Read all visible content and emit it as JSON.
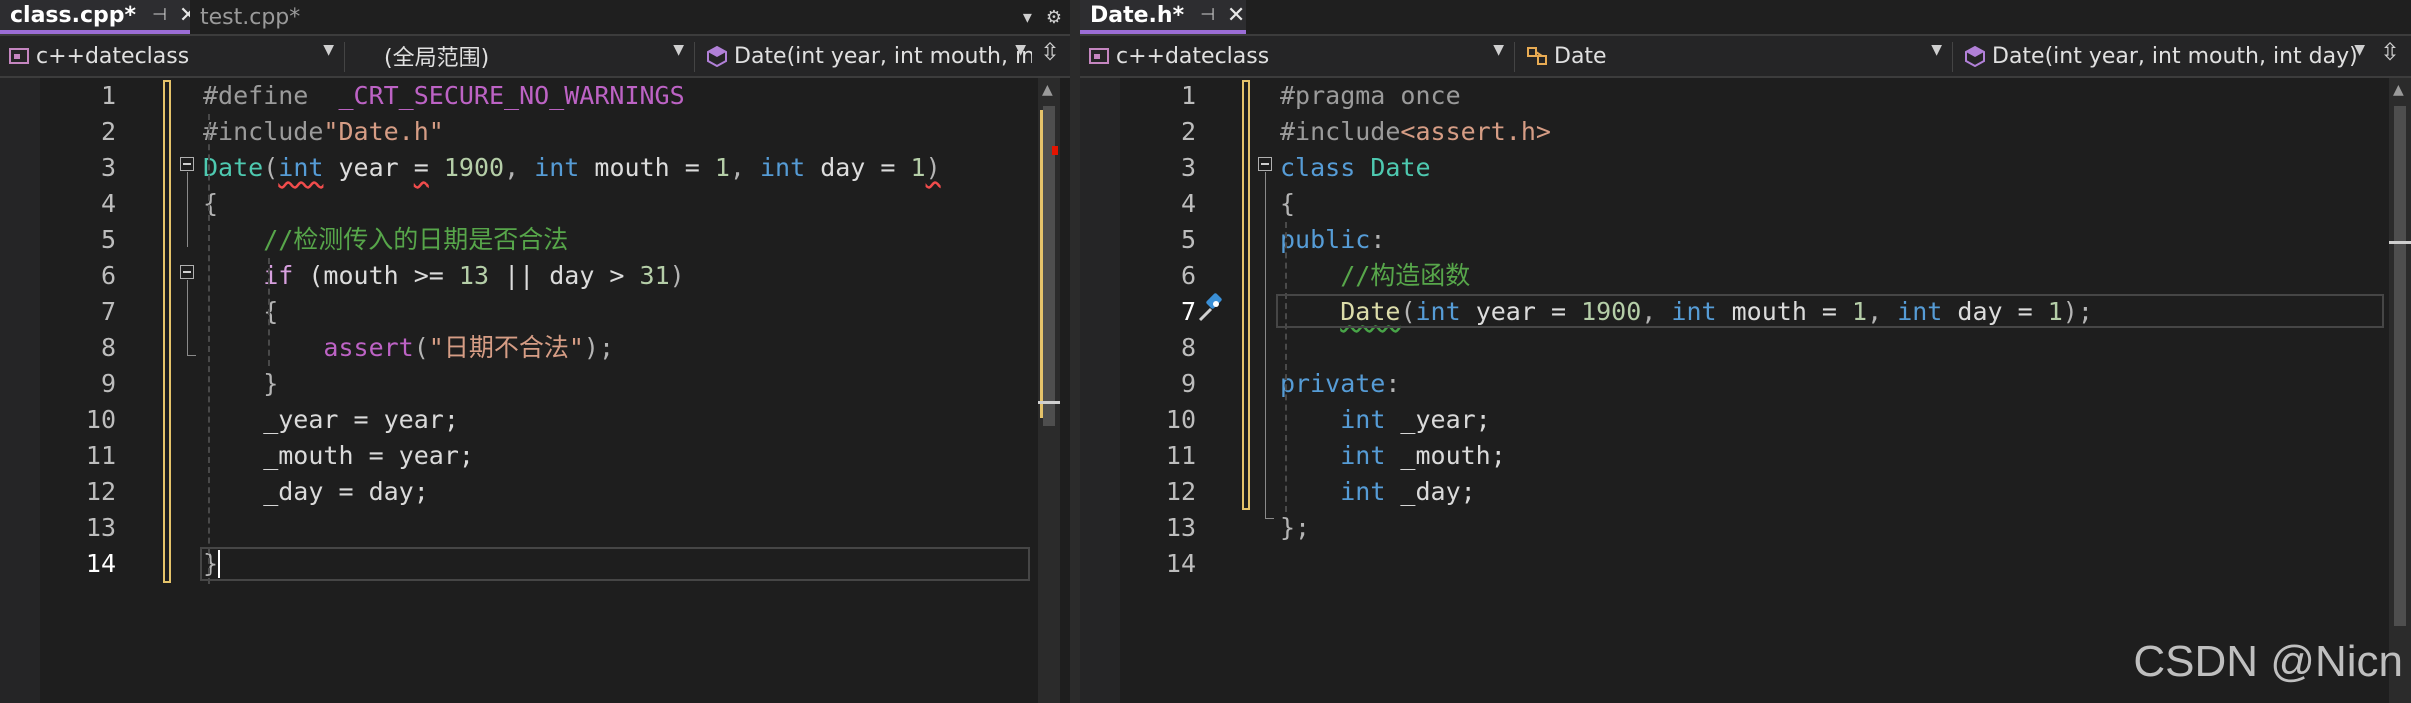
{
  "left": {
    "tabs": [
      {
        "label": "class.cpp*",
        "active": true
      },
      {
        "label": "test.cpp*",
        "active": false
      }
    ],
    "nav": {
      "project": "c++dateclass",
      "scope": "(全局范围)",
      "member": "Date(int year, int mouth, int"
    },
    "line_numbers": [
      "1",
      "2",
      "3",
      "4",
      "5",
      "6",
      "7",
      "8",
      "9",
      "10",
      "11",
      "12",
      "13",
      "14"
    ],
    "code": [
      [
        {
          "t": "#define  ",
          "c": "pp"
        },
        {
          "t": "_CRT_SECURE_NO_WARNINGS",
          "c": "macro"
        }
      ],
      [
        {
          "t": "#include",
          "c": "pp"
        },
        {
          "t": "\"Date.h\"",
          "c": "str"
        }
      ],
      [
        {
          "t": "Date",
          "c": "type"
        },
        {
          "t": "(",
          "c": "punc"
        },
        {
          "t": "int",
          "c": "kw",
          "s": "r"
        },
        {
          "t": " year ",
          "c": "plain"
        },
        {
          "t": "=",
          "c": "plain",
          "s": "r"
        },
        {
          "t": " ",
          "c": "plain"
        },
        {
          "t": "1900",
          "c": "num"
        },
        {
          "t": ", ",
          "c": "punc"
        },
        {
          "t": "int",
          "c": "kw"
        },
        {
          "t": " mouth = ",
          "c": "plain"
        },
        {
          "t": "1",
          "c": "num"
        },
        {
          "t": ", ",
          "c": "punc"
        },
        {
          "t": "int",
          "c": "kw"
        },
        {
          "t": " day = ",
          "c": "plain"
        },
        {
          "t": "1",
          "c": "num"
        },
        {
          "t": ")",
          "c": "punc",
          "s": "r"
        }
      ],
      [
        {
          "t": "{",
          "c": "punc"
        }
      ],
      [
        {
          "t": "    //检测传入的日期是否合法",
          "c": "com"
        }
      ],
      [
        {
          "t": "    ",
          "c": "plain"
        },
        {
          "t": "if",
          "c": "ctrl"
        },
        {
          "t": " (mouth >= ",
          "c": "plain"
        },
        {
          "t": "13",
          "c": "num"
        },
        {
          "t": " || day > ",
          "c": "plain"
        },
        {
          "t": "31",
          "c": "num"
        },
        {
          "t": ")",
          "c": "punc"
        }
      ],
      [
        {
          "t": "    {",
          "c": "punc"
        }
      ],
      [
        {
          "t": "        ",
          "c": "plain"
        },
        {
          "t": "assert",
          "c": "macro"
        },
        {
          "t": "(",
          "c": "punc"
        },
        {
          "t": "\"日期不合法\"",
          "c": "str"
        },
        {
          "t": ");",
          "c": "punc"
        }
      ],
      [
        {
          "t": "    }",
          "c": "punc"
        }
      ],
      [
        {
          "t": "    _year = year;",
          "c": "field"
        }
      ],
      [
        {
          "t": "    _mouth = year;",
          "c": "field"
        }
      ],
      [
        {
          "t": "    _day = day;",
          "c": "field"
        }
      ],
      [
        {
          "t": "",
          "c": "plain"
        }
      ],
      [
        {
          "t": "}",
          "c": "punc"
        }
      ]
    ],
    "current_line": 14
  },
  "right": {
    "tabs": [
      {
        "label": "Date.h*",
        "active": true
      }
    ],
    "nav": {
      "project": "c++dateclass",
      "scope": "Date",
      "member": "Date(int year, int mouth, int day)"
    },
    "line_numbers": [
      "1",
      "2",
      "3",
      "4",
      "5",
      "6",
      "7",
      "8",
      "9",
      "10",
      "11",
      "12",
      "13",
      "14"
    ],
    "code": [
      [
        {
          "t": "#pragma once",
          "c": "pp"
        }
      ],
      [
        {
          "t": "#include",
          "c": "pp"
        },
        {
          "t": "<assert.h>",
          "c": "str"
        }
      ],
      [
        {
          "t": "class",
          "c": "kw"
        },
        {
          "t": " ",
          "c": "plain"
        },
        {
          "t": "Date",
          "c": "type"
        }
      ],
      [
        {
          "t": "{",
          "c": "punc"
        }
      ],
      [
        {
          "t": "public",
          "c": "kw"
        },
        {
          "t": ":",
          "c": "punc"
        }
      ],
      [
        {
          "t": "    //构造函数",
          "c": "com"
        }
      ],
      [
        {
          "t": "    ",
          "c": "plain"
        },
        {
          "t": "Date",
          "c": "fn",
          "s": "g"
        },
        {
          "t": "(",
          "c": "punc"
        },
        {
          "t": "int",
          "c": "kw"
        },
        {
          "t": " year = ",
          "c": "plain"
        },
        {
          "t": "1900",
          "c": "num"
        },
        {
          "t": ", ",
          "c": "punc"
        },
        {
          "t": "int",
          "c": "kw"
        },
        {
          "t": " mouth = ",
          "c": "plain"
        },
        {
          "t": "1",
          "c": "num"
        },
        {
          "t": ", ",
          "c": "punc"
        },
        {
          "t": "int",
          "c": "kw"
        },
        {
          "t": " day = ",
          "c": "plain"
        },
        {
          "t": "1",
          "c": "num"
        },
        {
          "t": ");",
          "c": "punc"
        }
      ],
      [
        {
          "t": "",
          "c": "plain"
        }
      ],
      [
        {
          "t": "private",
          "c": "kw"
        },
        {
          "t": ":",
          "c": "punc"
        }
      ],
      [
        {
          "t": "    ",
          "c": "plain"
        },
        {
          "t": "int",
          "c": "kw"
        },
        {
          "t": " _year;",
          "c": "field"
        }
      ],
      [
        {
          "t": "    ",
          "c": "plain"
        },
        {
          "t": "int",
          "c": "kw"
        },
        {
          "t": " _mouth;",
          "c": "field"
        }
      ],
      [
        {
          "t": "    ",
          "c": "plain"
        },
        {
          "t": "int",
          "c": "kw"
        },
        {
          "t": " _day;",
          "c": "field"
        }
      ],
      [
        {
          "t": "};",
          "c": "punc"
        }
      ],
      [
        {
          "t": "",
          "c": "plain"
        }
      ]
    ],
    "current_line": 7
  },
  "watermark": "CSDN @Nicn",
  "colors": {
    "accent": "#9b6dd6",
    "change_marker": "#e5c36a",
    "error": "#e51400"
  }
}
